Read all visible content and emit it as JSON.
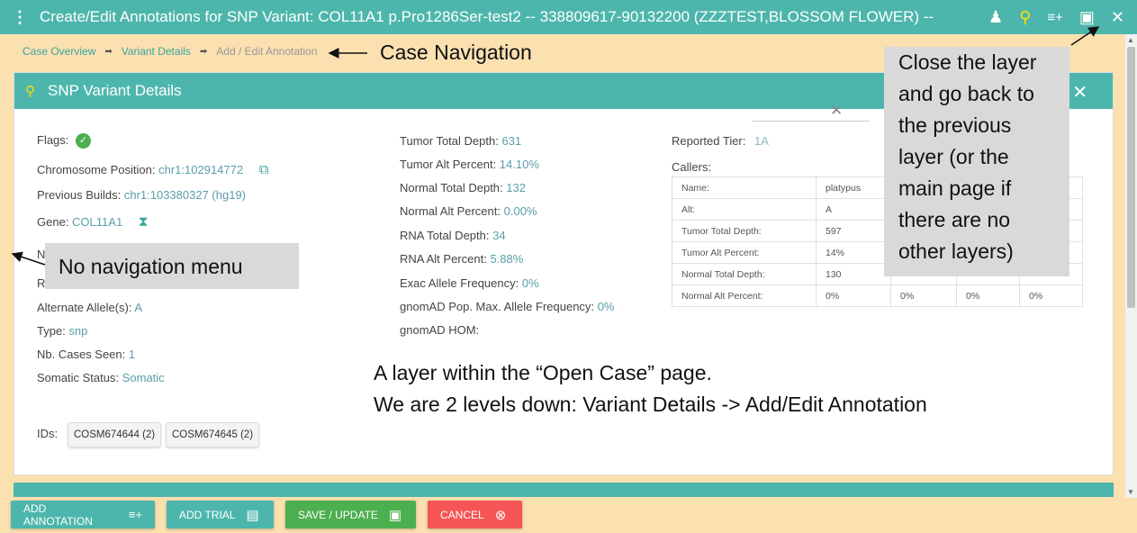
{
  "topbar": {
    "title": "Create/Edit Annotations for SNP Variant: COL11A1 p.Pro1286Ser-test2 -- 338809617-90132200 (ZZZTEST,BLOSSOM FLOWER) --",
    "menu_icon": "⋮",
    "user_icon": "♟",
    "search_icon": "⚲",
    "add_list_icon": "≡+",
    "save_icon": "▣",
    "close_icon": "✕"
  },
  "breadcrumb": {
    "items": [
      "Case Overview",
      "Variant Details",
      "Add / Edit Annotation"
    ],
    "separator": "➡"
  },
  "card": {
    "title": "SNP Variant Details",
    "search_icon": "⚲",
    "close_icon": "✕",
    "left": {
      "flags_label": "Flags:",
      "check_icon": "✓",
      "chrom_label": "Chromosome Position:",
      "chrom_value": "chr1:102914772",
      "prev_label": "Previous Builds:",
      "prev_value": "chr1:103380327 (hg19)",
      "gene_label": "Gene:",
      "gene_value": "COL11A1",
      "n_partial": "N",
      "r_partial": "R",
      "alt_label": "Alternate Allele(s):",
      "alt_value": "A",
      "type_label": "Type:",
      "type_value": "snp",
      "cases_label": "Nb. Cases Seen:",
      "cases_value": "1",
      "somatic_label": "Somatic Status:",
      "somatic_value": "Somatic",
      "ids_label": "IDs:",
      "ids": [
        "COSM674644 (2)",
        "COSM674645 (2)"
      ]
    },
    "middle": {
      "tumor_depth_label": "Tumor Total Depth:",
      "tumor_depth_value": "631",
      "tumor_alt_label": "Tumor Alt Percent:",
      "tumor_alt_value": "14.10%",
      "normal_depth_label": "Normal Total Depth:",
      "normal_depth_value": "132",
      "normal_alt_label": "Normal Alt Percent:",
      "normal_alt_value": "0.00%",
      "rna_depth_label": "RNA Total Depth:",
      "rna_depth_value": "34",
      "rna_alt_label": "RNA Alt Percent:",
      "rna_alt_value": "5.88%",
      "exac_label": "Exac Allele Frequency:",
      "exac_value": "0%",
      "gnomad_label": "gnomAD Pop. Max. Allele Frequency:",
      "gnomad_value": "0%",
      "gnomad_hom_label": "gnomAD HOM:"
    },
    "right": {
      "tier_label": "Reported Tier:",
      "tier_value": "1A",
      "tier_clear_icon": "✕",
      "callers_label": "Callers:",
      "callers_rows": [
        {
          "label": "Name:",
          "c1": "platypus",
          "c2": "",
          "c3": "",
          "c4": ""
        },
        {
          "label": "Alt:",
          "c1": "A",
          "c2": "",
          "c3": "",
          "c4": ""
        },
        {
          "label": "Tumor Total Depth:",
          "c1": "597",
          "c2": "",
          "c3": "",
          "c4": ""
        },
        {
          "label": "Tumor Alt Percent:",
          "c1": "14%",
          "c2": "",
          "c3": "",
          "c4": ""
        },
        {
          "label": "Normal Total Depth:",
          "c1": "130",
          "c2": "",
          "c3": "",
          "c4": ""
        },
        {
          "label": "Normal Alt Percent:",
          "c1": "0%",
          "c2": "0%",
          "c3": "0%",
          "c4": "0%"
        }
      ]
    }
  },
  "buttons": {
    "add_annotation": "ADD ANNOTATION",
    "add_annotation_icon": "≡+",
    "add_trial": "ADD TRIAL",
    "add_trial_icon": "▤",
    "save_update": "SAVE / UPDATE",
    "save_icon": "▣",
    "cancel": "CANCEL",
    "cancel_icon": "⊗"
  },
  "annotations": {
    "case_navigation": "Case Navigation",
    "no_nav_menu": "No navigation menu",
    "close_layer": [
      "Close the layer",
      "and go back to",
      "the previous",
      "layer (or the",
      "main page if",
      "there are no",
      "other layers)"
    ],
    "layer_note_1": "A layer within the “Open Case” page.",
    "layer_note_2": "We are 2 levels down: Variant Details -> Add/Edit Annotation"
  }
}
